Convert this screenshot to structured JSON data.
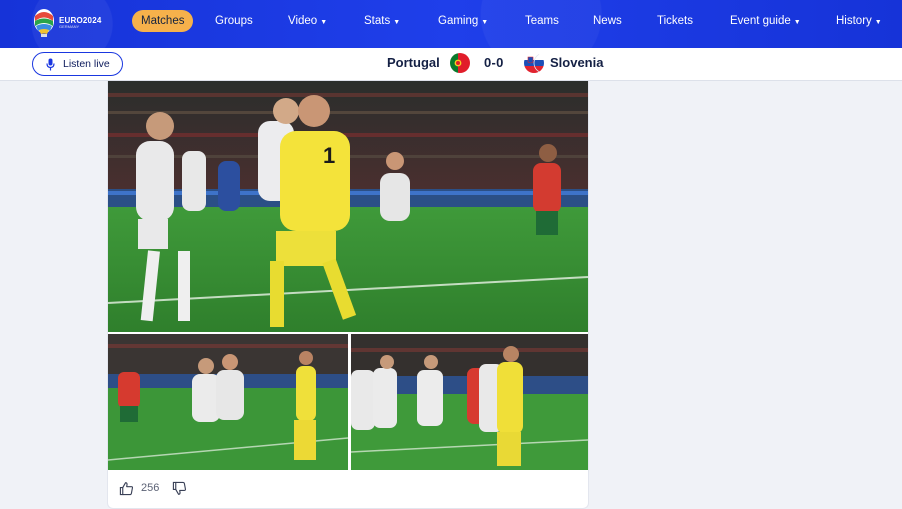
{
  "nav": {
    "logo": {
      "line1": "EURO2024",
      "line2": "",
      "line3": "GERMANY"
    },
    "items": [
      {
        "label": "Matches",
        "active": true,
        "dropdown": false
      },
      {
        "label": "Groups",
        "active": false,
        "dropdown": false
      },
      {
        "label": "Video",
        "active": false,
        "dropdown": true
      },
      {
        "label": "Stats",
        "active": false,
        "dropdown": true
      },
      {
        "label": "Gaming",
        "active": false,
        "dropdown": true
      },
      {
        "label": "Teams",
        "active": false,
        "dropdown": false
      },
      {
        "label": "News",
        "active": false,
        "dropdown": false
      },
      {
        "label": "Tickets",
        "active": false,
        "dropdown": false
      },
      {
        "label": "Event guide",
        "active": false,
        "dropdown": true
      },
      {
        "label": "History",
        "active": false,
        "dropdown": true
      }
    ],
    "caret": "▼"
  },
  "scorebar": {
    "listen_label": "Listen live",
    "home_team": "Portugal",
    "score": "0-0",
    "away_team": "Slovenia"
  },
  "post": {
    "photos": [
      {
        "icon": "match-photo-celebration"
      },
      {
        "icon": "match-photo-team-hug"
      },
      {
        "icon": "match-photo-keeper-embrace"
      }
    ],
    "likes": "256"
  },
  "colors": {
    "nav_bg": "#1a37e0",
    "active_pill": "#f6b14b",
    "text_dark": "#142044",
    "page_bg": "#f0f2f7"
  }
}
